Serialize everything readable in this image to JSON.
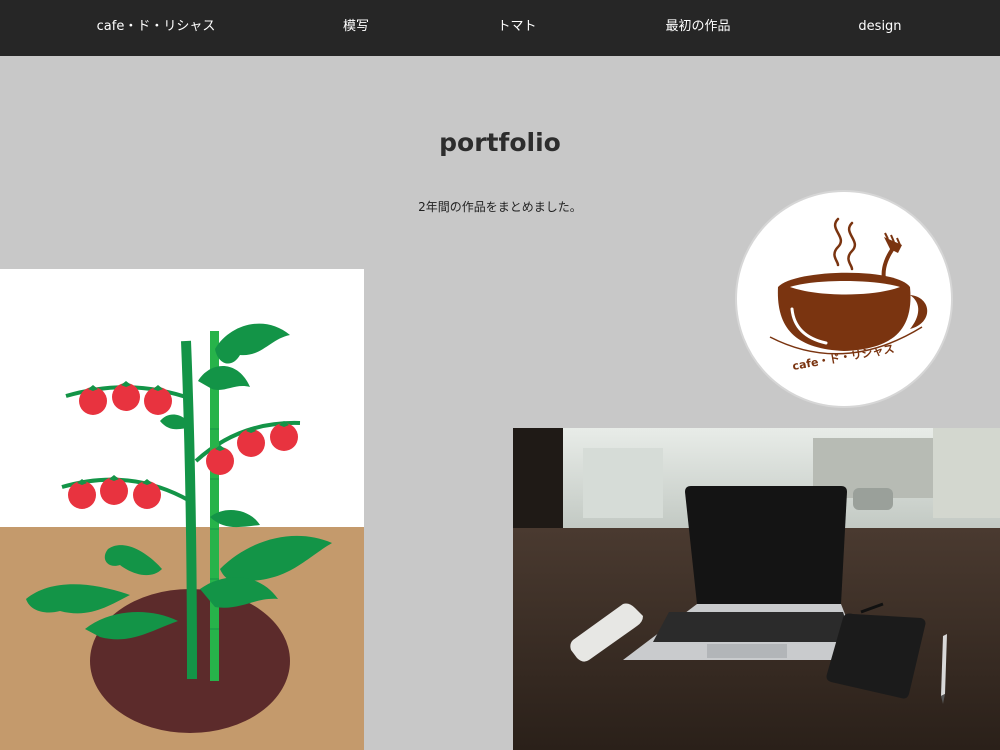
{
  "nav": {
    "items": [
      {
        "label": "cafe・ド・リシャス"
      },
      {
        "label": "模写"
      },
      {
        "label": "トマト"
      },
      {
        "label": "最初の作品"
      },
      {
        "label": "design"
      }
    ]
  },
  "hero": {
    "title": "portfolio",
    "subtitle": "2年間の作品をまとめました。"
  },
  "works": {
    "logo": {
      "text": "cafe・ド・リシャス"
    }
  },
  "colors": {
    "nav_bg": "#262626",
    "page_bg": "#c8c8c8",
    "logo_brown": "#7a3410",
    "tomato_red": "#e8333f",
    "leaf_green": "#139447",
    "soil_tan": "#c49a6c",
    "soil_dark": "#5c2b2b"
  }
}
